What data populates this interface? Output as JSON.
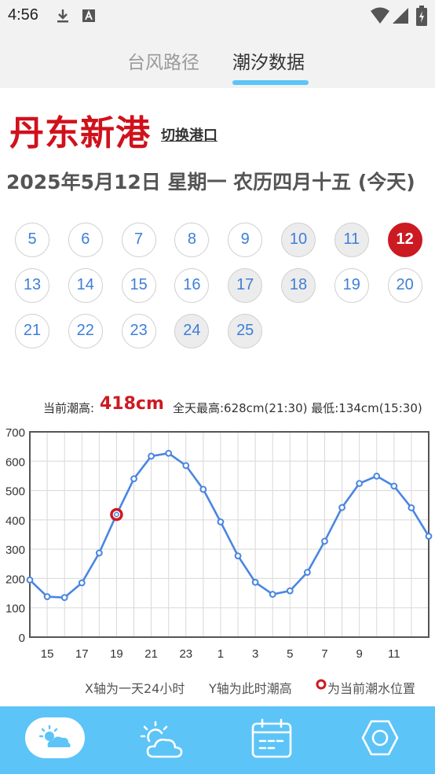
{
  "status_bar": {
    "time": "4:56"
  },
  "tabs": [
    {
      "label": "台风路径",
      "active": false
    },
    {
      "label": "潮汐数据",
      "active": true
    }
  ],
  "port": {
    "name": "丹东新港",
    "switch_label": "切换港口"
  },
  "date_line": "2025年5月12日 星期一 农历四月十五 (今天)",
  "days": [
    {
      "label": "5",
      "state": "normal"
    },
    {
      "label": "6",
      "state": "normal"
    },
    {
      "label": "7",
      "state": "normal"
    },
    {
      "label": "8",
      "state": "normal"
    },
    {
      "label": "9",
      "state": "normal"
    },
    {
      "label": "10",
      "state": "grey"
    },
    {
      "label": "11",
      "state": "grey"
    },
    {
      "label": "12",
      "state": "today"
    },
    {
      "label": "13",
      "state": "normal"
    },
    {
      "label": "14",
      "state": "normal"
    },
    {
      "label": "15",
      "state": "normal"
    },
    {
      "label": "16",
      "state": "normal"
    },
    {
      "label": "17",
      "state": "grey"
    },
    {
      "label": "18",
      "state": "grey"
    },
    {
      "label": "19",
      "state": "normal"
    },
    {
      "label": "20",
      "state": "normal"
    },
    {
      "label": "21",
      "state": "normal"
    },
    {
      "label": "22",
      "state": "normal"
    },
    {
      "label": "23",
      "state": "normal"
    },
    {
      "label": "24",
      "state": "grey"
    },
    {
      "label": "25",
      "state": "grey"
    }
  ],
  "tide": {
    "current_label": "当前潮高:",
    "current_value": "418cm",
    "day_range": "全天最高:628cm(21:30) 最低:134cm(15:30)"
  },
  "chart_data": {
    "type": "line",
    "x": [
      13,
      14,
      15,
      16,
      17,
      18,
      19,
      20,
      21,
      22,
      23,
      0,
      1,
      2,
      3,
      4,
      5,
      6,
      7,
      8,
      9,
      10,
      11,
      12
    ],
    "x_tick_labels": [
      "15",
      "17",
      "19",
      "21",
      "23",
      "1",
      "3",
      "5",
      "7",
      "9",
      "11"
    ],
    "y_ticks": [
      0,
      100,
      200,
      300,
      400,
      500,
      600,
      700
    ],
    "ylim": [
      0,
      700
    ],
    "values": [
      195,
      138,
      135,
      185,
      287,
      418,
      540,
      617,
      627,
      585,
      504,
      393,
      277,
      187,
      146,
      158,
      221,
      327,
      442,
      524,
      549,
      515,
      441,
      344
    ],
    "current_index": 5,
    "grid": true,
    "line_color": "#4a86e0",
    "marker_color": "#cc1a22"
  },
  "legend": {
    "x_axis": "X轴为一天24小时",
    "y_axis": "Y轴为此时潮高",
    "marker": "为当前潮水位置"
  },
  "bottom_nav": [
    {
      "icon": "weather-icon",
      "active": true
    },
    {
      "icon": "partly-sunny-icon",
      "active": false
    },
    {
      "icon": "calendar-icon",
      "active": false
    },
    {
      "icon": "settings-icon",
      "active": false
    }
  ],
  "colors": {
    "accent": "#5cc4f7",
    "port_red": "#d0111c",
    "today_red": "#cc1a22",
    "day_blue": "#3d7fd8"
  }
}
